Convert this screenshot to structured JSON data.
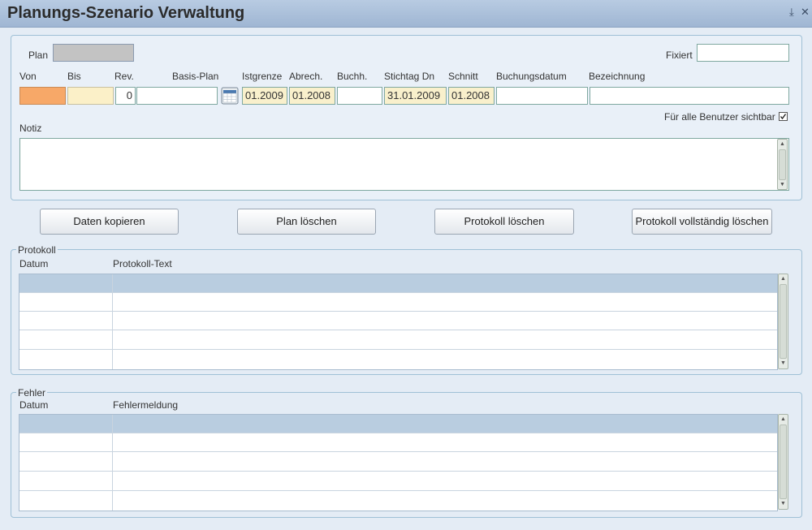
{
  "window": {
    "title": "Planungs-Szenario Verwaltung",
    "minimize_glyph": "⤓",
    "close_glyph": "✕"
  },
  "form": {
    "plan_label": "Plan",
    "plan_value": "",
    "fixiert_label": "Fixiert",
    "fixiert_value": "",
    "columns": {
      "von": "Von",
      "bis": "Bis",
      "rev": "Rev.",
      "basis_plan": "Basis-Plan",
      "istgrenze": "Istgrenze",
      "abrech": "Abrech.",
      "buchh": "Buchh.",
      "stichtag": "Stichtag Dn",
      "schnitt": "Schnitt",
      "buchungsdatum": "Buchungsdatum",
      "bezeichnung": "Bezeichnung"
    },
    "values": {
      "von": "",
      "bis": "",
      "rev": "0",
      "basis_plan": "",
      "istgrenze": "01.2009",
      "abrech": "01.2008",
      "buchh": "",
      "stichtag": "31.01.2009",
      "schnitt": "01.2008",
      "buchungsdatum": "",
      "bezeichnung": ""
    },
    "sichtbar_label": "Für alle Benutzer sichtbar",
    "sichtbar_checked": true,
    "notiz_label": "Notiz",
    "notiz_value": ""
  },
  "buttons": {
    "daten_kopieren": "Daten kopieren",
    "plan_loeschen": "Plan löschen",
    "protokoll_loeschen": "Protokoll löschen",
    "protokoll_voll_loeschen": "Protokoll vollständig löschen"
  },
  "protokoll": {
    "legend": "Protokoll",
    "headers": [
      "Datum",
      "Protokoll-Text"
    ],
    "rows": 5
  },
  "fehler": {
    "legend": "Fehler",
    "headers": [
      "Datum",
      "Fehlermeldung"
    ],
    "rows": 5
  },
  "colors": {
    "von_field": "#f7a868",
    "bis_field": "#fbf0c8",
    "plan_field": "#c3c3c3",
    "header_row": "#b9cde0"
  }
}
